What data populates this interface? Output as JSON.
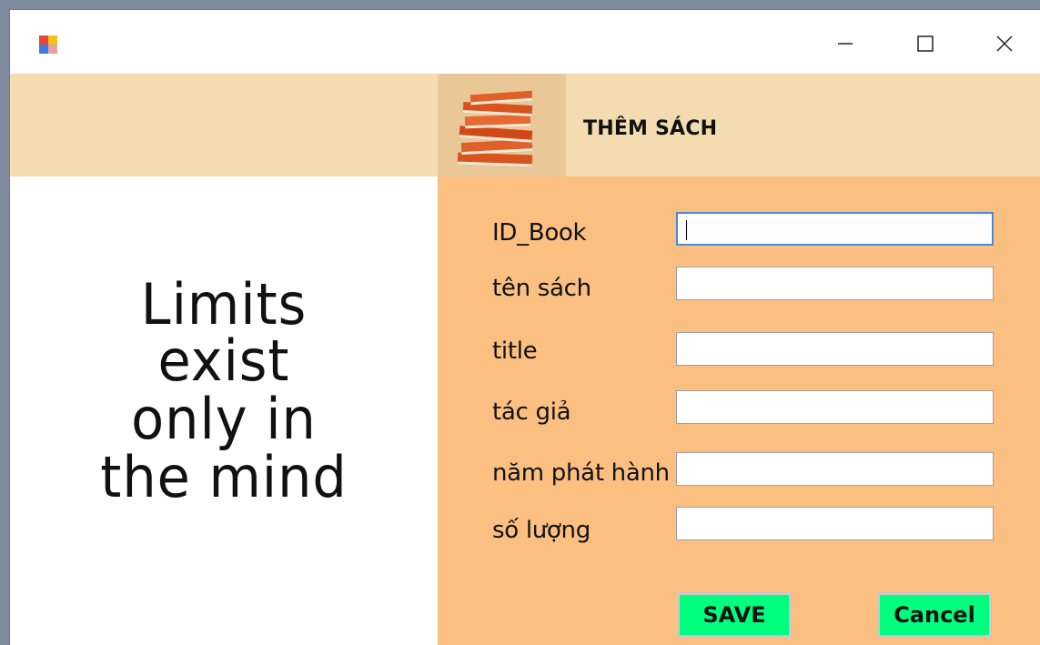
{
  "window": {
    "icon": "app-icon",
    "controls": [
      "minimize-icon",
      "maximize-icon",
      "close-icon"
    ]
  },
  "header": {
    "title": "THÊM SÁCH",
    "icon": "book-stack-icon"
  },
  "quote": {
    "lines": [
      "Limits",
      "exist",
      "only in",
      "the mind"
    ]
  },
  "form": {
    "fields": [
      {
        "label": "ID_Book",
        "value": ""
      },
      {
        "label": "tên sách",
        "value": ""
      },
      {
        "label": "title",
        "value": ""
      },
      {
        "label": "tác giả",
        "value": ""
      },
      {
        "label": "năm phát hành",
        "value": ""
      },
      {
        "label": "số lượng",
        "value": ""
      }
    ],
    "save_label": "SAVE",
    "cancel_label": "Cancel"
  },
  "colors": {
    "header_bg": "#f5dcb0",
    "form_bg": "#fbbf82",
    "button_bg": "#00ff7f"
  }
}
